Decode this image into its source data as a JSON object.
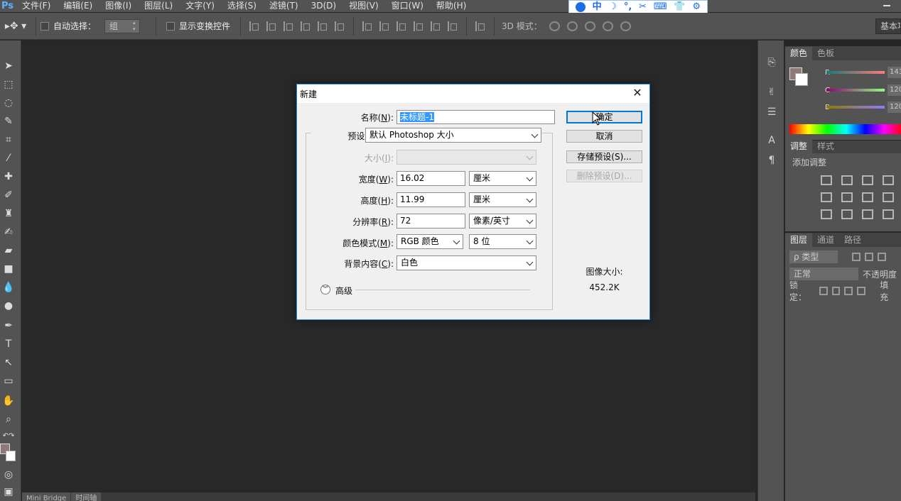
{
  "app": {
    "logo": "Ps",
    "menu": [
      "文件(F)",
      "编辑(E)",
      "图像(I)",
      "图层(L)",
      "文字(Y)",
      "选择(S)",
      "滤镜(T)",
      "3D(D)",
      "视图(V)",
      "窗口(W)",
      "帮助(H)"
    ]
  },
  "ime_toolbar": {
    "items": [
      "中",
      "☽",
      "°,",
      "✂",
      "⌨",
      "👕",
      "⚙"
    ]
  },
  "options_bar": {
    "auto_select_label": "自动选择：",
    "auto_select_value": "组",
    "show_transform_label": "显示变换控件",
    "mode_3d_label": "3D 模式：",
    "workspace_label": "基本功能"
  },
  "canvas_tabs": [
    "Mini Bridge",
    "时间轴"
  ],
  "panels": {
    "color": {
      "tabs": [
        "颜色",
        "色板"
      ],
      "channels": [
        {
          "label": "R",
          "value": "143"
        },
        {
          "label": "G",
          "value": "120"
        },
        {
          "label": "B",
          "value": "120"
        }
      ],
      "foreground_color": "#8f7a78",
      "background_color": "#ffffff"
    },
    "adjustments": {
      "tabs": [
        "调整",
        "样式"
      ],
      "subtitle": "添加调整"
    },
    "layers": {
      "tabs": [
        "图层",
        "通道",
        "路径"
      ],
      "filter_type": "ρ 类型",
      "blend_mode": "正常",
      "opacity_label": "不透明度",
      "lock_label": "锁定：",
      "fill_label": "填充"
    }
  },
  "dialog": {
    "title": "新建",
    "name_label": "名称(",
    "name_key": "N",
    "name_value": "未标题-1",
    "preset_label": "预设(",
    "preset_key": "P",
    "preset_value": "默认 Photoshop 大小",
    "size_label": "大小(",
    "size_key": "I",
    "size_value": "",
    "width_label": "宽度(",
    "width_key": "W",
    "width_value": "16.02",
    "width_unit": "厘米",
    "height_label": "高度(",
    "height_key": "H",
    "height_value": "11.99",
    "height_unit": "厘米",
    "resolution_label": "分辨率(",
    "resolution_key": "R",
    "resolution_value": "72",
    "resolution_unit": "像素/英寸",
    "color_mode_label": "颜色模式(",
    "color_mode_key": "M",
    "color_mode_value": "RGB 颜色",
    "bit_depth_value": "8 位",
    "background_label": "背景内容(",
    "background_key": "C",
    "background_value": "白色",
    "advanced_label": "高级",
    "ok_button": "确定",
    "cancel_button": "取消",
    "save_preset_button": "存储预设(S)...",
    "delete_preset_button": "删除预设(D)...",
    "image_size_label": "图像大小:",
    "image_size_value": "452.2K",
    "close_symbol": "✕",
    "label_suffix": "):"
  }
}
